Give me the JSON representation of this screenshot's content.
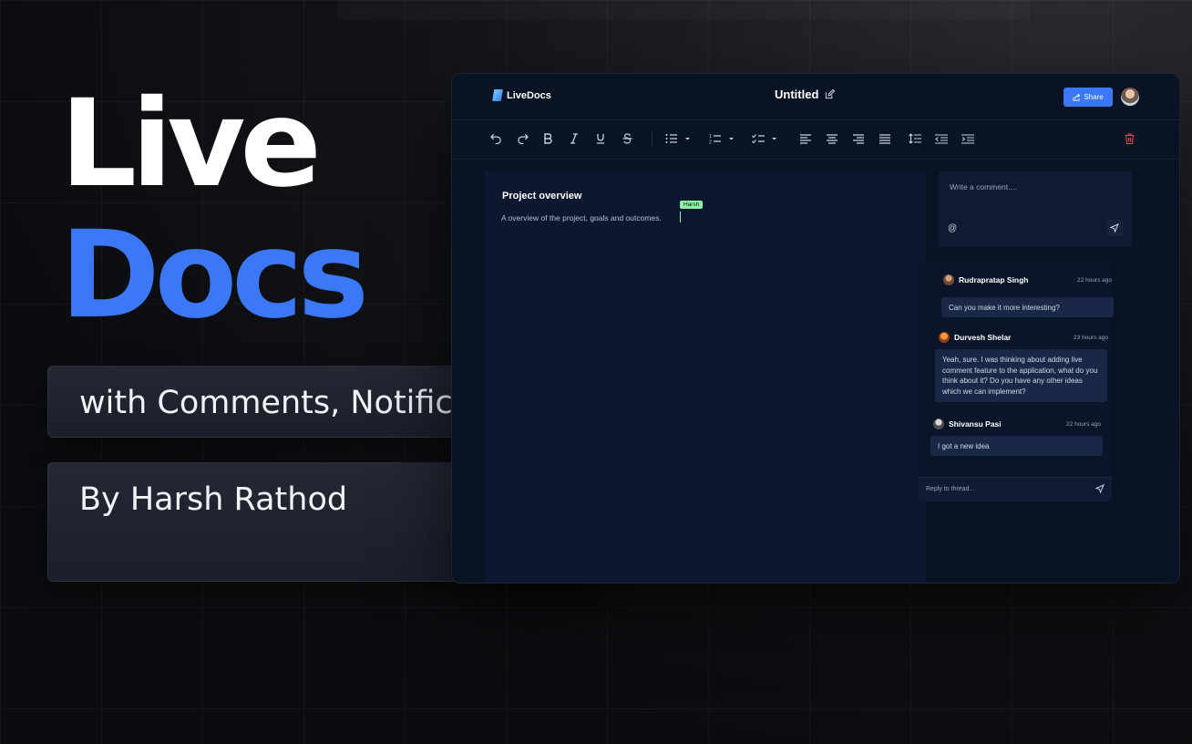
{
  "hero": {
    "line1": "Live",
    "line2": "Docs",
    "tagline": "with Comments, Notifications",
    "author": "By Harsh Rathod"
  },
  "colors": {
    "accent": "#3b78f6",
    "cursor": "#8ef5a6",
    "delete": "#e5484d"
  },
  "app": {
    "logo_text": "LiveDocs",
    "doc_title": "Untitled",
    "share_label": "Share",
    "toolbar_icons": [
      "undo-icon",
      "redo-icon",
      "bold-icon",
      "italic-icon",
      "underline-icon",
      "strikethrough-icon",
      "bullet-list-icon",
      "numbered-list-icon",
      "checklist-icon",
      "align-left-icon",
      "align-center-icon",
      "align-right-icon",
      "align-justify-icon",
      "line-height-icon",
      "outdent-icon",
      "indent-icon",
      "trash-icon"
    ],
    "editor": {
      "heading": "Project overview",
      "body": "A overview of the project, goals and outcomes.",
      "cursor_user": "Harsh"
    },
    "comment_input": {
      "placeholder": "Write a comment....",
      "mention_symbol": "@"
    },
    "thread": {
      "comments": [
        {
          "author": "Rudrapratap Singh",
          "time": "22 hours ago",
          "text": "Can you make it more interesting?"
        },
        {
          "author": "Durvesh Shelar",
          "time": "23 hours ago",
          "text": "Yeah, sure. I was thinking about adding live comment feature to the application, what do you think about it? Do you have any other ideas which we can implement?"
        },
        {
          "author": "Shivansu Pasi",
          "time": "22 hours ago",
          "text": "I got a new idea"
        }
      ],
      "reply_placeholder": "Reply to thread..."
    }
  }
}
